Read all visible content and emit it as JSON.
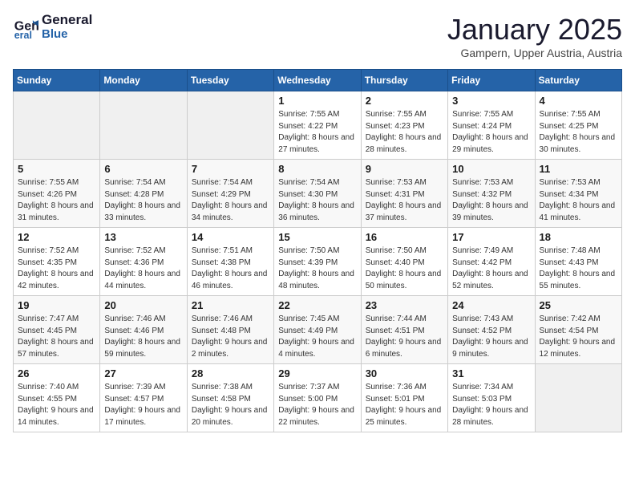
{
  "header": {
    "logo_line1": "General",
    "logo_line2": "Blue",
    "title": "January 2025",
    "subtitle": "Gampern, Upper Austria, Austria"
  },
  "weekdays": [
    "Sunday",
    "Monday",
    "Tuesday",
    "Wednesday",
    "Thursday",
    "Friday",
    "Saturday"
  ],
  "weeks": [
    [
      {
        "day": "",
        "info": ""
      },
      {
        "day": "",
        "info": ""
      },
      {
        "day": "",
        "info": ""
      },
      {
        "day": "1",
        "info": "Sunrise: 7:55 AM\nSunset: 4:22 PM\nDaylight: 8 hours and 27 minutes."
      },
      {
        "day": "2",
        "info": "Sunrise: 7:55 AM\nSunset: 4:23 PM\nDaylight: 8 hours and 28 minutes."
      },
      {
        "day": "3",
        "info": "Sunrise: 7:55 AM\nSunset: 4:24 PM\nDaylight: 8 hours and 29 minutes."
      },
      {
        "day": "4",
        "info": "Sunrise: 7:55 AM\nSunset: 4:25 PM\nDaylight: 8 hours and 30 minutes."
      }
    ],
    [
      {
        "day": "5",
        "info": "Sunrise: 7:55 AM\nSunset: 4:26 PM\nDaylight: 8 hours and 31 minutes."
      },
      {
        "day": "6",
        "info": "Sunrise: 7:54 AM\nSunset: 4:28 PM\nDaylight: 8 hours and 33 minutes."
      },
      {
        "day": "7",
        "info": "Sunrise: 7:54 AM\nSunset: 4:29 PM\nDaylight: 8 hours and 34 minutes."
      },
      {
        "day": "8",
        "info": "Sunrise: 7:54 AM\nSunset: 4:30 PM\nDaylight: 8 hours and 36 minutes."
      },
      {
        "day": "9",
        "info": "Sunrise: 7:53 AM\nSunset: 4:31 PM\nDaylight: 8 hours and 37 minutes."
      },
      {
        "day": "10",
        "info": "Sunrise: 7:53 AM\nSunset: 4:32 PM\nDaylight: 8 hours and 39 minutes."
      },
      {
        "day": "11",
        "info": "Sunrise: 7:53 AM\nSunset: 4:34 PM\nDaylight: 8 hours and 41 minutes."
      }
    ],
    [
      {
        "day": "12",
        "info": "Sunrise: 7:52 AM\nSunset: 4:35 PM\nDaylight: 8 hours and 42 minutes."
      },
      {
        "day": "13",
        "info": "Sunrise: 7:52 AM\nSunset: 4:36 PM\nDaylight: 8 hours and 44 minutes."
      },
      {
        "day": "14",
        "info": "Sunrise: 7:51 AM\nSunset: 4:38 PM\nDaylight: 8 hours and 46 minutes."
      },
      {
        "day": "15",
        "info": "Sunrise: 7:50 AM\nSunset: 4:39 PM\nDaylight: 8 hours and 48 minutes."
      },
      {
        "day": "16",
        "info": "Sunrise: 7:50 AM\nSunset: 4:40 PM\nDaylight: 8 hours and 50 minutes."
      },
      {
        "day": "17",
        "info": "Sunrise: 7:49 AM\nSunset: 4:42 PM\nDaylight: 8 hours and 52 minutes."
      },
      {
        "day": "18",
        "info": "Sunrise: 7:48 AM\nSunset: 4:43 PM\nDaylight: 8 hours and 55 minutes."
      }
    ],
    [
      {
        "day": "19",
        "info": "Sunrise: 7:47 AM\nSunset: 4:45 PM\nDaylight: 8 hours and 57 minutes."
      },
      {
        "day": "20",
        "info": "Sunrise: 7:46 AM\nSunset: 4:46 PM\nDaylight: 8 hours and 59 minutes."
      },
      {
        "day": "21",
        "info": "Sunrise: 7:46 AM\nSunset: 4:48 PM\nDaylight: 9 hours and 2 minutes."
      },
      {
        "day": "22",
        "info": "Sunrise: 7:45 AM\nSunset: 4:49 PM\nDaylight: 9 hours and 4 minutes."
      },
      {
        "day": "23",
        "info": "Sunrise: 7:44 AM\nSunset: 4:51 PM\nDaylight: 9 hours and 6 minutes."
      },
      {
        "day": "24",
        "info": "Sunrise: 7:43 AM\nSunset: 4:52 PM\nDaylight: 9 hours and 9 minutes."
      },
      {
        "day": "25",
        "info": "Sunrise: 7:42 AM\nSunset: 4:54 PM\nDaylight: 9 hours and 12 minutes."
      }
    ],
    [
      {
        "day": "26",
        "info": "Sunrise: 7:40 AM\nSunset: 4:55 PM\nDaylight: 9 hours and 14 minutes."
      },
      {
        "day": "27",
        "info": "Sunrise: 7:39 AM\nSunset: 4:57 PM\nDaylight: 9 hours and 17 minutes."
      },
      {
        "day": "28",
        "info": "Sunrise: 7:38 AM\nSunset: 4:58 PM\nDaylight: 9 hours and 20 minutes."
      },
      {
        "day": "29",
        "info": "Sunrise: 7:37 AM\nSunset: 5:00 PM\nDaylight: 9 hours and 22 minutes."
      },
      {
        "day": "30",
        "info": "Sunrise: 7:36 AM\nSunset: 5:01 PM\nDaylight: 9 hours and 25 minutes."
      },
      {
        "day": "31",
        "info": "Sunrise: 7:34 AM\nSunset: 5:03 PM\nDaylight: 9 hours and 28 minutes."
      },
      {
        "day": "",
        "info": ""
      }
    ]
  ]
}
